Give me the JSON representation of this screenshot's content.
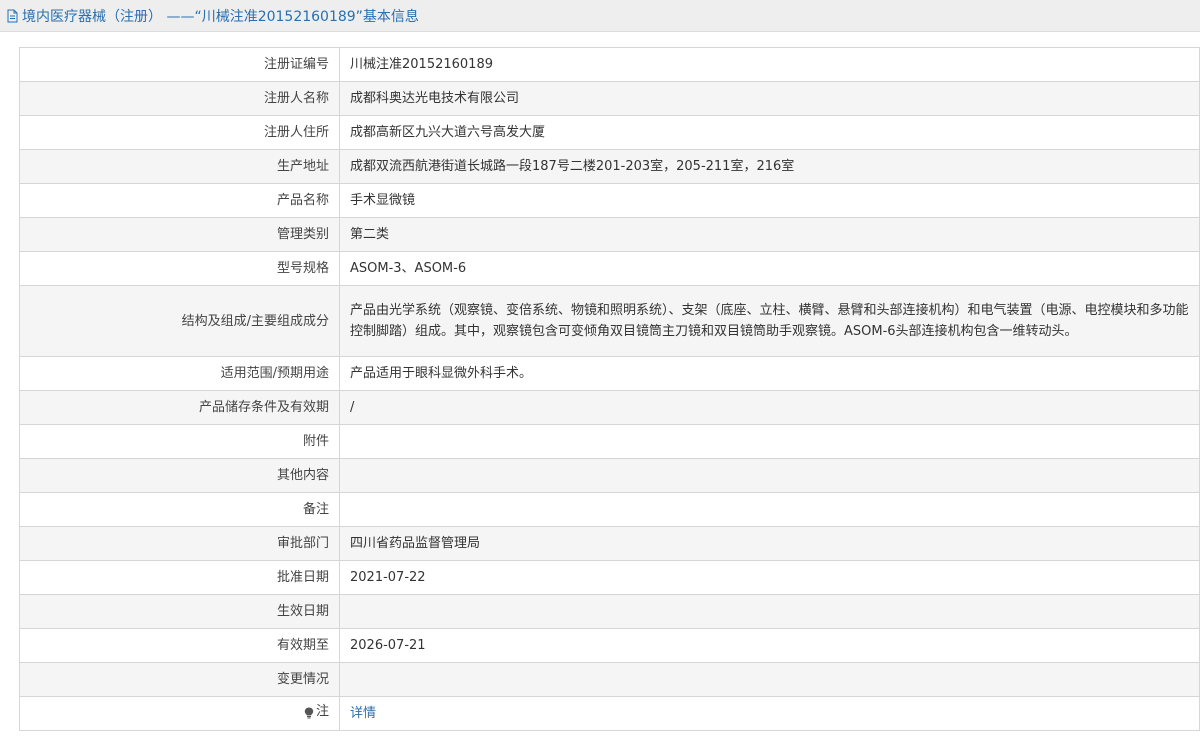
{
  "page": {
    "title": "境内医疗器械（注册） ——“川械注准20152160189”基本信息"
  },
  "rows": [
    {
      "label": "注册证编号",
      "value": "川械注准20152160189"
    },
    {
      "label": "注册人名称",
      "value": "成都科奥达光电技术有限公司"
    },
    {
      "label": "注册人住所",
      "value": "成都高新区九兴大道六号高发大厦"
    },
    {
      "label": "生产地址",
      "value": "成都双流西航港街道长城路一段187号二楼201-203室，205-211室，216室"
    },
    {
      "label": "产品名称",
      "value": "手术显微镜"
    },
    {
      "label": "管理类别",
      "value": "第二类"
    },
    {
      "label": "型号规格",
      "value": "ASOM-3、ASOM-6"
    },
    {
      "label": "结构及组成/主要组成成分",
      "value": "产品由光学系统（观察镜、变倍系统、物镜和照明系统）、支架（底座、立柱、横臂、悬臂和头部连接机构）和电气装置（电源、电控模块和多功能控制脚踏）组成。其中，观察镜包含可变倾角双目镜筒主刀镜和双目镜筒助手观察镜。ASOM-6头部连接机构包含一维转动头。"
    },
    {
      "label": "适用范围/预期用途",
      "value": "产品适用于眼科显微外科手术。"
    },
    {
      "label": "产品储存条件及有效期",
      "value": "/"
    },
    {
      "label": "附件",
      "value": ""
    },
    {
      "label": "其他内容",
      "value": ""
    },
    {
      "label": "备注",
      "value": ""
    },
    {
      "label": "审批部门",
      "value": "四川省药品监督管理局"
    },
    {
      "label": "批准日期",
      "value": "2021-07-22"
    },
    {
      "label": "生效日期",
      "value": ""
    },
    {
      "label": "有效期至",
      "value": "2026-07-21"
    },
    {
      "label": "变更情况",
      "value": ""
    }
  ],
  "note": {
    "label": "注",
    "link_text": "详情",
    "icon": "lightbulb-icon"
  },
  "colors": {
    "accent": "#2a6fb0",
    "header_bg": "#eeeeee",
    "border": "#d6d6d6",
    "stripe": "#f5f5f5"
  }
}
